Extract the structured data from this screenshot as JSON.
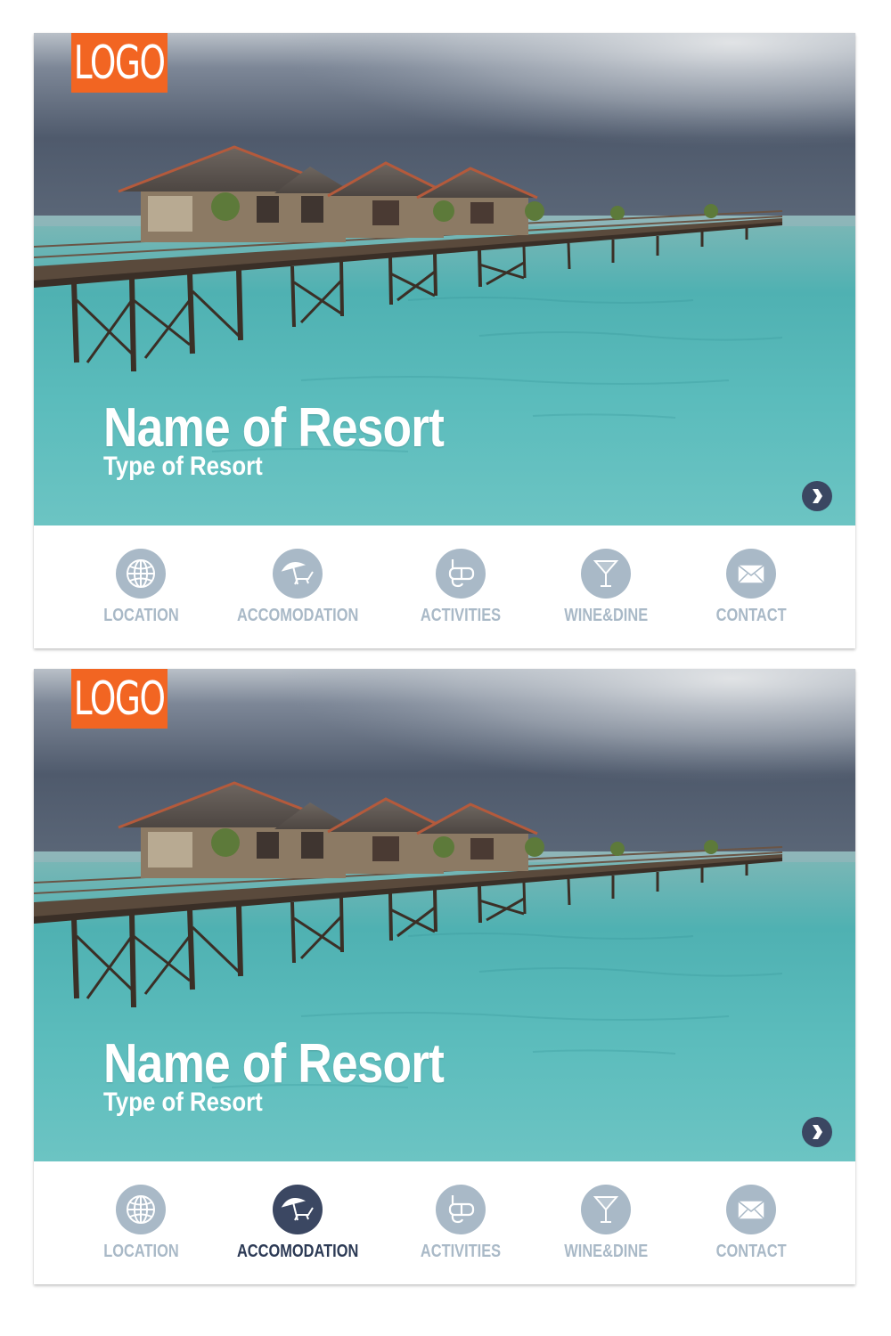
{
  "colors": {
    "logo_bg": "#f26522",
    "nav_inactive": "#a9b9c7",
    "nav_active": "#3b4762",
    "nav_active_label": "#2c3a55",
    "next_button": "#3b4762"
  },
  "cards": [
    {
      "logo": "LOGO",
      "title": "Name of Resort",
      "subtitle": "Type of Resort",
      "next_icon": "chevron-right-icon",
      "nav": [
        {
          "label": "LOCATION",
          "icon": "globe-icon",
          "active": false
        },
        {
          "label": "ACCOMODATION",
          "icon": "beach-umbrella-icon",
          "active": false
        },
        {
          "label": "ACTIVITIES",
          "icon": "snorkel-mask-icon",
          "active": false
        },
        {
          "label": "WINE&DINE",
          "icon": "martini-glass-icon",
          "active": false
        },
        {
          "label": "CONTACT",
          "icon": "envelope-icon",
          "active": false
        }
      ]
    },
    {
      "logo": "LOGO",
      "title": "Name of Resort",
      "subtitle": "Type of Resort",
      "next_icon": "chevron-right-icon",
      "nav": [
        {
          "label": "LOCATION",
          "icon": "globe-icon",
          "active": false
        },
        {
          "label": "ACCOMODATION",
          "icon": "beach-umbrella-icon",
          "active": true
        },
        {
          "label": "ACTIVITIES",
          "icon": "snorkel-mask-icon",
          "active": false
        },
        {
          "label": "WINE&DINE",
          "icon": "martini-glass-icon",
          "active": false
        },
        {
          "label": "CONTACT",
          "icon": "envelope-icon",
          "active": false
        }
      ]
    }
  ]
}
